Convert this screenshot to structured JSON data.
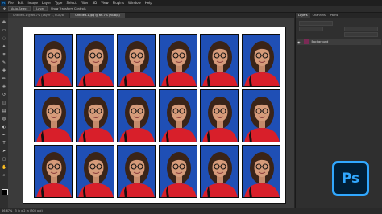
{
  "menubar": {
    "app_badge": "Ps",
    "items": [
      "File",
      "Edit",
      "Image",
      "Layer",
      "Type",
      "Select",
      "Filter",
      "3D",
      "View",
      "Plugins",
      "Window",
      "Help"
    ]
  },
  "options_bar": {
    "auto_select": "Auto-Select",
    "layer": "Layer",
    "transform": "Show Transform Controls"
  },
  "tabs": [
    {
      "label": "Untitled-1 @ 66.7% (Layer 1, RGB/8)",
      "active": false
    },
    {
      "label": "Untitled-1.jpg @ 66.7% (RGB/8)",
      "active": true
    }
  ],
  "tools": [
    "move-icon",
    "marquee-icon",
    "lasso-icon",
    "quick-select-icon",
    "crop-icon",
    "eyedropper-icon",
    "healing-icon",
    "brush-icon",
    "stamp-icon",
    "history-brush-icon",
    "eraser-icon",
    "gradient-icon",
    "blur-icon",
    "dodge-icon",
    "pen-icon",
    "type-icon",
    "path-select-icon",
    "shape-icon",
    "hand-icon",
    "zoom-icon",
    "edit-toolbar-icon",
    "foreground-color-icon"
  ],
  "panels": {
    "tabs": [
      "Layers",
      "Channels",
      "Paths"
    ],
    "active_tab": "Layers",
    "layer_name": "Background"
  },
  "status": {
    "zoom": "66.67%",
    "doc_info": "3 in x 2 in (300 ppi)"
  },
  "photo_grid": {
    "rows": 3,
    "cols": 6
  },
  "colors": {
    "photo_background": "#1f4fb5",
    "shirt": "#d81f2a",
    "ps_accent": "#31a8ff",
    "ps_bg": "#001e36"
  },
  "logo": {
    "text": "Ps"
  }
}
